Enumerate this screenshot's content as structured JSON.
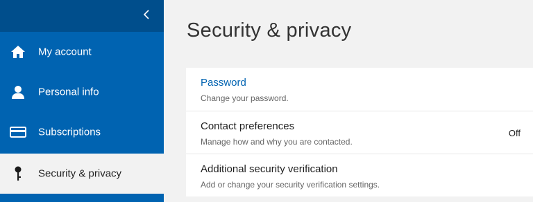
{
  "sidebar": {
    "collapse_icon": "chevron-left-icon",
    "items": [
      {
        "label": "My account",
        "icon": "home-icon"
      },
      {
        "label": "Personal info",
        "icon": "person-icon"
      },
      {
        "label": "Subscriptions",
        "icon": "credit-card-icon"
      },
      {
        "label": "Security & privacy",
        "icon": "key-icon",
        "active": true
      }
    ]
  },
  "main": {
    "title": "Security & privacy",
    "settings": [
      {
        "title": "Password",
        "description": "Change your password."
      },
      {
        "title": "Contact preferences",
        "description": "Manage how and why you are contacted.",
        "value": "Off"
      },
      {
        "title": "Additional security verification",
        "description": "Add or change your security verification settings."
      }
    ]
  },
  "colors": {
    "sidebar_bg": "#0063b1",
    "sidebar_top_bg": "#004e8c",
    "page_bg": "#f2f2f2",
    "link": "#0063b1"
  }
}
